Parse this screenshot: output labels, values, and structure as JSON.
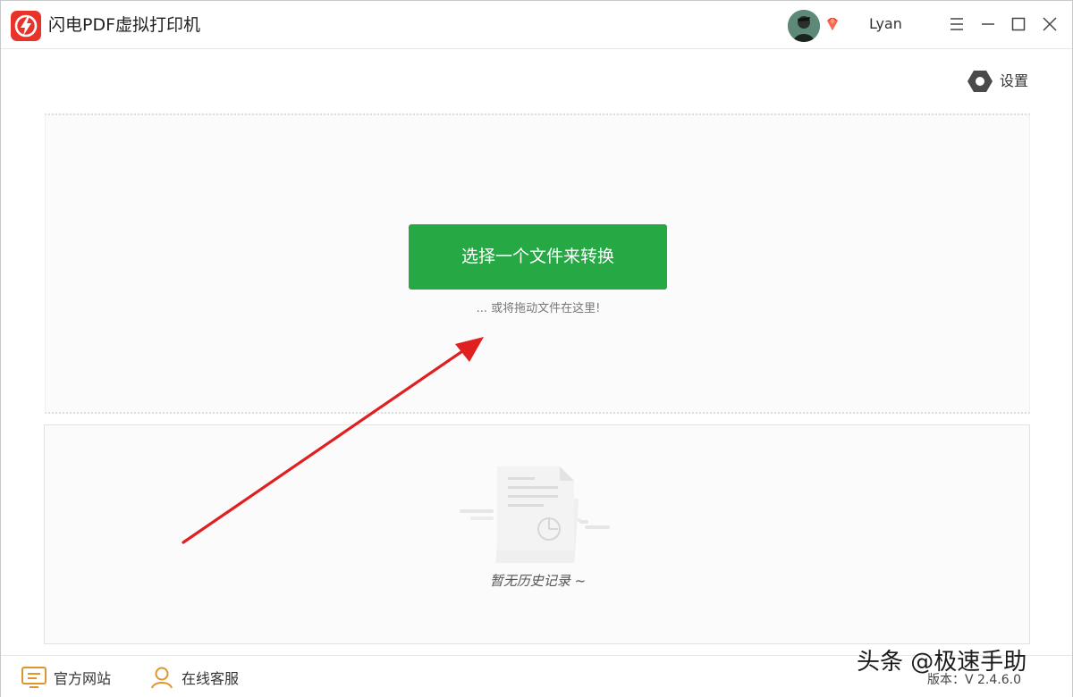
{
  "app": {
    "title": "闪电PDF虚拟打印机",
    "logo_icon": "lightning-pdf-logo",
    "brand_color": "#e8332b"
  },
  "user": {
    "name": "Lyan",
    "vip_icon": "vip-diamond-icon"
  },
  "window_controls": {
    "menu_icon": "menu-icon",
    "minimize_icon": "minimize-icon",
    "maximize_icon": "maximize-icon",
    "close_icon": "close-icon"
  },
  "settings": {
    "label": "设置",
    "icon": "gear-icon"
  },
  "dropzone": {
    "button_label": "选择一个文件来转换",
    "button_color": "#26a845",
    "hint": "... 或将拖动文件在这里!"
  },
  "history": {
    "empty_text": "暂无历史记录 ~",
    "illustration_icon": "empty-document-icon"
  },
  "footer": {
    "website_label": "官方网站",
    "support_label": "在线客服",
    "version_label": "版本：V 2.4.6.0"
  },
  "watermark": "头条 @极速手助",
  "annotation_color": "#e02020"
}
